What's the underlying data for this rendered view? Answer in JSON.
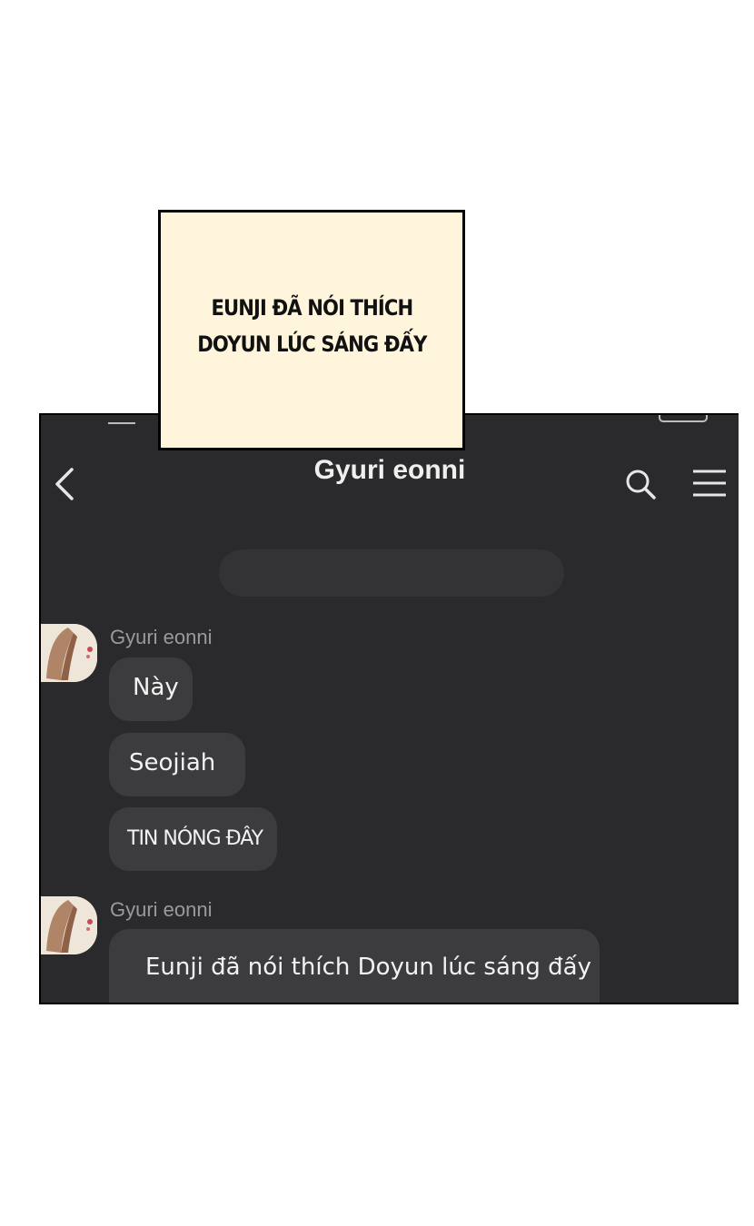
{
  "caption": {
    "line1": "EUNJI ĐÃ NÓI THÍCH",
    "line2": "DOYUN LÚC SÁNG ĐẤY"
  },
  "chat": {
    "title": "Gyuri eonni",
    "icons": {
      "back": "chevron-left-icon",
      "search": "search-icon",
      "menu": "hamburger-menu-icon"
    },
    "groups": [
      {
        "sender": "Gyuri eonni",
        "messages": [
          "Này",
          "Seojiah",
          "TIN NÓNG ĐÂY"
        ]
      },
      {
        "sender": "Gyuri eonni",
        "messages": [
          "Eunji đã nói thích Doyun lúc sáng đấy"
        ]
      }
    ]
  },
  "colors": {
    "background": "#2a2a2c",
    "bubble": "#3c3c3f",
    "caption_bg": "#fff5dc"
  }
}
